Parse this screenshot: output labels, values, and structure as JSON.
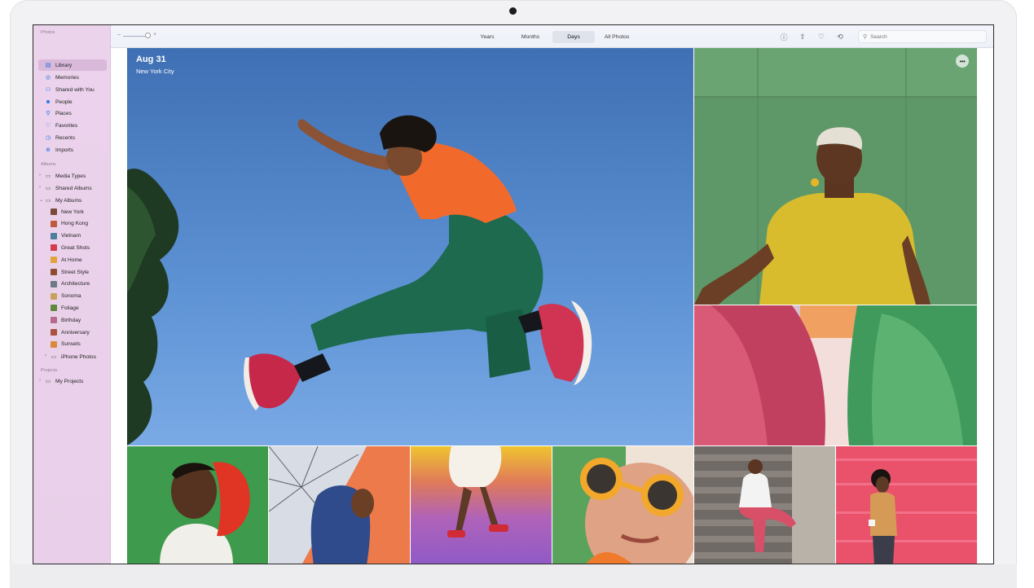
{
  "sidebar": {
    "sections": {
      "photos": "Photos",
      "albums": "Albums",
      "projects": "Projects"
    },
    "library_items": [
      {
        "label": "Library",
        "icon": "photos-library-icon"
      },
      {
        "label": "Memories",
        "icon": "memories-icon"
      },
      {
        "label": "Shared with You",
        "icon": "shared-with-you-icon"
      },
      {
        "label": "People",
        "icon": "people-icon"
      },
      {
        "label": "Places",
        "icon": "places-icon"
      },
      {
        "label": "Favorites",
        "icon": "heart-icon"
      },
      {
        "label": "Recents",
        "icon": "clock-icon"
      },
      {
        "label": "Imports",
        "icon": "import-icon"
      }
    ],
    "album_groups": [
      {
        "label": "Media Types"
      },
      {
        "label": "Shared Albums"
      },
      {
        "label": "My Albums"
      }
    ],
    "albums": [
      {
        "label": "New York",
        "color": "#7a4a3a"
      },
      {
        "label": "Hong Kong",
        "color": "#c05a3c"
      },
      {
        "label": "Vietnam",
        "color": "#4f7f9a"
      },
      {
        "label": "Great Shots",
        "color": "#d23c4c"
      },
      {
        "label": "At Home",
        "color": "#e1a33b"
      },
      {
        "label": "Street Style",
        "color": "#8e4d2e"
      },
      {
        "label": "Architecture",
        "color": "#6b7a86"
      },
      {
        "label": "Sonoma",
        "color": "#c9a05c"
      },
      {
        "label": "Foliage",
        "color": "#5f8a3d"
      },
      {
        "label": "Birthday",
        "color": "#b66b8e"
      },
      {
        "label": "Anniversary",
        "color": "#a8523f"
      },
      {
        "label": "Sunsets",
        "color": "#d98a3c"
      }
    ],
    "iphone_photos": "iPhone Photos",
    "projects": [
      {
        "label": "My Projects"
      }
    ]
  },
  "toolbar": {
    "zoom_minus": "–",
    "zoom_plus": "+",
    "tabs": [
      {
        "label": "Years"
      },
      {
        "label": "Months"
      },
      {
        "label": "Days"
      },
      {
        "label": "All Photos"
      }
    ],
    "search_placeholder": "Search"
  },
  "featured": {
    "date": "Aug 31",
    "location": "New York City",
    "more": "•••"
  },
  "colors": {
    "sidebar": "#ecd3ec",
    "accent": "#1d71e6",
    "sky": "#6ea2dc"
  }
}
